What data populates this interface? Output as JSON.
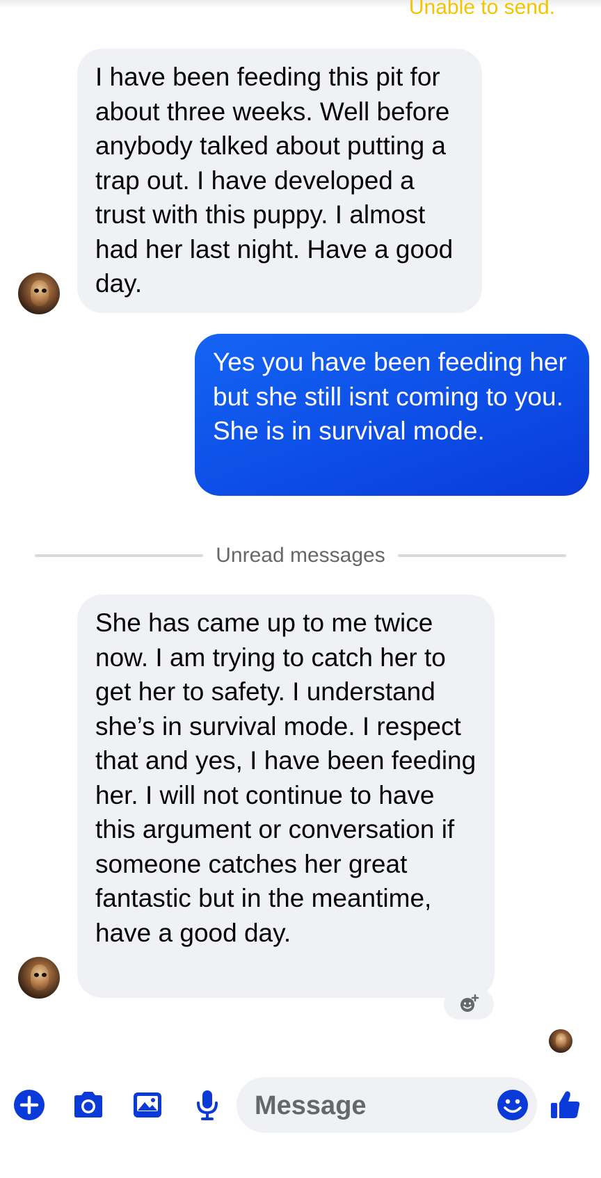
{
  "conversation": {
    "status_text": "Unable to send.",
    "messages": [
      {
        "direction": "incoming",
        "text": "I have been feeding this pit for about three weeks. Well before anybody talked about putting a trap out. I have developed a trust with this puppy. I almost had her last night. Have a good day."
      },
      {
        "direction": "outgoing",
        "text": "Yes you have been feeding her but she still isnt coming to you.  She is in survival mode."
      },
      {
        "direction": "incoming",
        "text": "She has came up to me twice now. I am trying to catch her to get her to safety. I understand she’s in survival mode. I respect that and yes, I have been feeding her. I will not continue to have this argument or conversation if someone catches her great fantastic but in the meantime, have a good day."
      }
    ],
    "unread_divider_label": "Unread messages"
  },
  "composer": {
    "placeholder": "Message",
    "icons": {
      "add": "plus-circle-icon",
      "camera": "camera-icon",
      "gallery": "image-gallery-icon",
      "mic": "microphone-icon",
      "emoji": "smiley-icon",
      "like": "thumbs-up-icon",
      "reaction": "add-reaction-icon"
    }
  },
  "colors": {
    "accent": "#0a3ad8",
    "outgoing_bubble": "#1464f5",
    "incoming_bubble": "#f0f1f5",
    "status_warning": "#f5c400"
  }
}
